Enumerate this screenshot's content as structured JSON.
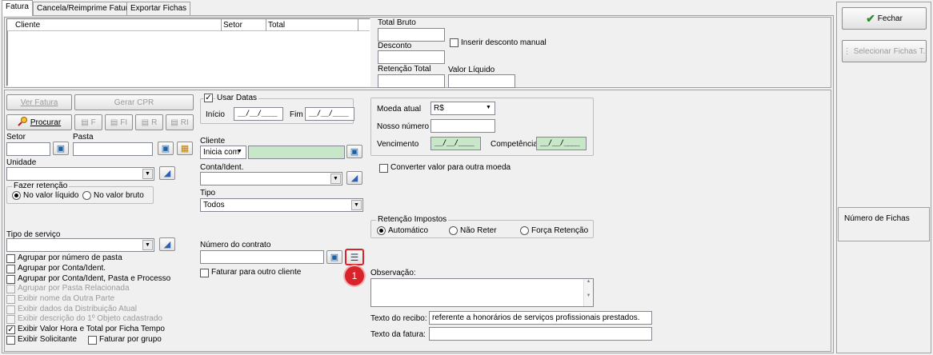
{
  "tabs": [
    {
      "label": "Fatura"
    },
    {
      "label": "Cancela/Reimprime Fatura"
    },
    {
      "label": "Exportar Fichas"
    }
  ],
  "grid": {
    "columns": [
      "Cliente",
      "Setor",
      "Total"
    ]
  },
  "totals": {
    "total_bruto": "Total Bruto",
    "desconto": "Desconto",
    "inserir_desconto": "Inserir desconto manual",
    "retencao_total": "Retenção Total",
    "valor_liquido": "Valor Líquido"
  },
  "buttons": {
    "ver_fatura": "Ver Fatura",
    "gerar_cpr": "Gerar CPR",
    "procurar": "Procurar",
    "f": "F",
    "fi": "FI",
    "r": "R",
    "ri": "RI",
    "fechar": "Fechar",
    "selecionar_fichas": "Selecionar Fichas T."
  },
  "filters": {
    "setor": "Setor",
    "pasta": "Pasta",
    "unidade": "Unidade",
    "fazer_retencao": "Fazer retenção",
    "no_valor_liquido": "No valor líquido",
    "no_valor_bruto": "No valor bruto",
    "tipo_servico": "Tipo de serviço"
  },
  "checkboxes": [
    {
      "label": "Agrupar por número de pasta",
      "checked": false,
      "disabled": false
    },
    {
      "label": "Agrupar por Conta/Ident.",
      "checked": false,
      "disabled": false
    },
    {
      "label": "Agrupar por Conta/Ident, Pasta e Processo",
      "checked": false,
      "disabled": false
    },
    {
      "label": "Agrupar por Pasta Relacionada",
      "checked": false,
      "disabled": true
    },
    {
      "label": "Exibir nome da Outra Parte",
      "checked": false,
      "disabled": true
    },
    {
      "label": "Exibir dados da Distribuição Atual",
      "checked": false,
      "disabled": true
    },
    {
      "label": "Exibir descrição do 1º Objeto cadastrado",
      "checked": false,
      "disabled": true
    },
    {
      "label": "Exibir Valor Hora e Total por Ficha Tempo",
      "checked": true,
      "disabled": false
    },
    {
      "label": "Exibir Solicitante",
      "checked": false,
      "disabled": false
    }
  ],
  "faturar_por_grupo": "Faturar por grupo",
  "datas": {
    "usar_datas": "Usar Datas",
    "inicio": "Início",
    "fim": "Fim",
    "inicio_value": "__/__/____",
    "fim_value": "__/__/____"
  },
  "cliente": {
    "label": "Cliente",
    "mode": "Inicia com"
  },
  "conta_ident": "Conta/Ident.",
  "tipo": {
    "label": "Tipo",
    "value": "Todos"
  },
  "contrato": {
    "label": "Número do contrato",
    "faturar_outro": "Faturar para outro cliente"
  },
  "badge": "1",
  "moeda": {
    "moeda_atual": "Moeda atual",
    "moeda_value": "R$",
    "nosso_numero": "Nosso número",
    "vencimento": "Vencimento",
    "vencimento_value": "__/__/____",
    "competencia": "Competência",
    "competencia_value": "__/__/____",
    "converter": "Converter valor para outra moeda"
  },
  "retencao_impostos": {
    "title": "Retenção Impostos",
    "automatico": "Automático",
    "nao_reter": "Não Reter",
    "forca_retencao": "Força Retenção"
  },
  "observacao": "Observação:",
  "texto_recibo": {
    "label": "Texto do recibo:",
    "value": "referente a honorários de serviços profissionais prestados."
  },
  "texto_fatura": {
    "label": "Texto da fatura:",
    "value": ""
  },
  "numero_fichas": "Número de Fichas",
  "colors": {
    "accent_red": "#d9232a",
    "green_field": "#c8e6c8",
    "check_green": "#2e8b2e"
  }
}
